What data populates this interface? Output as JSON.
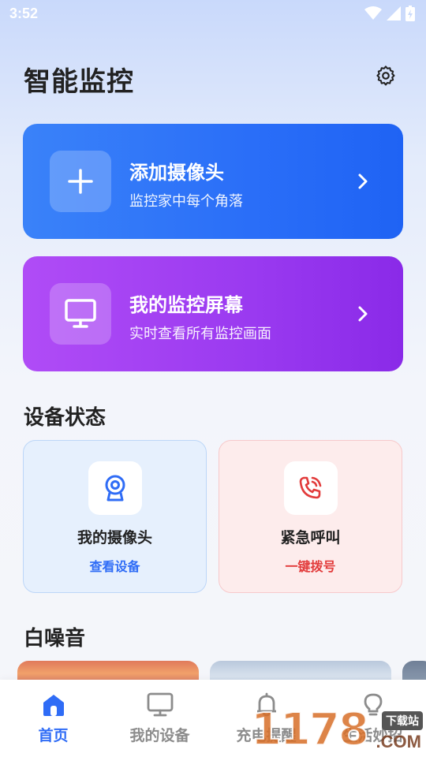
{
  "status_bar": {
    "time": "3:52",
    "icons": [
      "wifi-icon",
      "signal-icon",
      "battery-charging-icon"
    ]
  },
  "header": {
    "title": "智能监控",
    "settings_icon": "gear-icon"
  },
  "feature_cards": [
    {
      "title": "添加摄像头",
      "subtitle": "监控家中每个角落",
      "icon": "plus-icon",
      "color": "#2a6ef8"
    },
    {
      "title": "我的监控屏幕",
      "subtitle": "实时查看所有监控画面",
      "icon": "monitor-icon",
      "color": "#9a3af0"
    }
  ],
  "device_status": {
    "title": "设备状态",
    "cards": [
      {
        "label": "我的摄像头",
        "action": "查看设备",
        "icon": "webcam-icon",
        "accent": "#2f6cf6"
      },
      {
        "label": "紧急呼叫",
        "action": "一键拨号",
        "icon": "phone-call-icon",
        "accent": "#e23b3b"
      }
    ]
  },
  "white_noise": {
    "title": "白噪音"
  },
  "tab_bar": {
    "active_color": "#2f6cf6",
    "tabs": [
      {
        "label": "首页",
        "icon": "home-icon",
        "active": true
      },
      {
        "label": "我的设备",
        "icon": "monitor-icon",
        "active": false
      },
      {
        "label": "充电提醒",
        "icon": "bell-icon",
        "active": false
      },
      {
        "label": "生活妙招",
        "icon": "lightbulb-icon",
        "active": false
      }
    ]
  },
  "watermark": {
    "number": "1178",
    "badge": "下载站",
    "suffix": ".COM"
  }
}
